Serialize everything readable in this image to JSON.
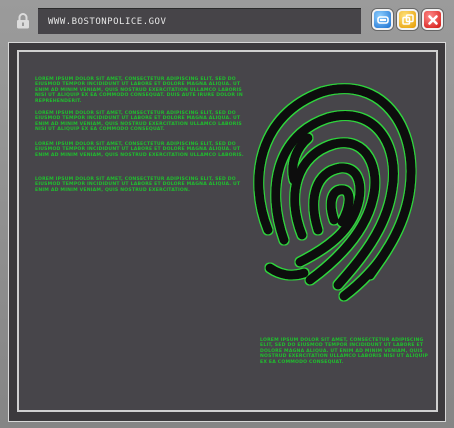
{
  "address_bar": {
    "url": "WWW.BOSTONPOLICE.GOV"
  },
  "icons": {
    "lock": "lock-icon",
    "minimize": "minimize-icon",
    "maximize": "maximize-icon",
    "close": "close-icon",
    "fingerprint": "fingerprint-icon"
  },
  "colors": {
    "text_green": "#1fbf2e",
    "fingerprint_glow": "#2fd63c",
    "panel": "#47454a"
  },
  "paragraphs": [
    "LOREM IPSUM DOLOR SIT AMET, CONSECTETUR ADIPISCING ELIT, SED DO EIUSMOD TEMPOR INCIDIDUNT UT LABORE ET DOLORE MAGNA ALIQUA. UT ENIM AD MINIM VENIAM, QUIS NOSTRUD EXERCITATION ULLAMCO LABORIS NISI UT ALIQUIP EX EA COMMODO CONSEQUAT. DUIS AUTE IRURE DOLOR IN REPREHENDERIT.",
    "LOREM IPSUM DOLOR SIT AMET, CONSECTETUR ADIPISCING ELIT, SED DO EIUSMOD TEMPOR INCIDIDUNT UT LABORE ET DOLORE MAGNA ALIQUA. UT ENIM AD MINIM VENIAM, QUIS NOSTRUD EXERCITATION ULLAMCO LABORIS NISI UT ALIQUIP EX EA COMMODO CONSEQUAT.",
    "LOREM IPSUM DOLOR SIT AMET, CONSECTETUR ADIPISCING ELIT, SED DO EIUSMOD TEMPOR INCIDIDUNT UT LABORE ET DOLORE MAGNA ALIQUA. UT ENIM AD MINIM VENIAM, QUIS NOSTRUD EXERCITATION ULLAMCO LABORIS.",
    "LOREM IPSUM DOLOR SIT AMET, CONSECTETUR ADIPISCING ELIT, SED DO EIUSMOD TEMPOR INCIDIDUNT UT LABORE ET DOLORE MAGNA ALIQUA. UT ENIM AD MINIM VENIAM, QUIS NOSTRUD EXERCITATION.",
    "LOREM IPSUM DOLOR SIT AMET, CONSECTETUR ADIPISCING ELIT, SED DO EIUSMOD TEMPOR INCIDIDUNT UT LABORE ET DOLORE MAGNA ALIQUA. UT ENIM AD MINIM VENIAM, QUIS NOSTRUD EXERCITATION ULLAMCO LABORIS NISI UT ALIQUIP EX EA COMMODO CONSEQUAT."
  ]
}
